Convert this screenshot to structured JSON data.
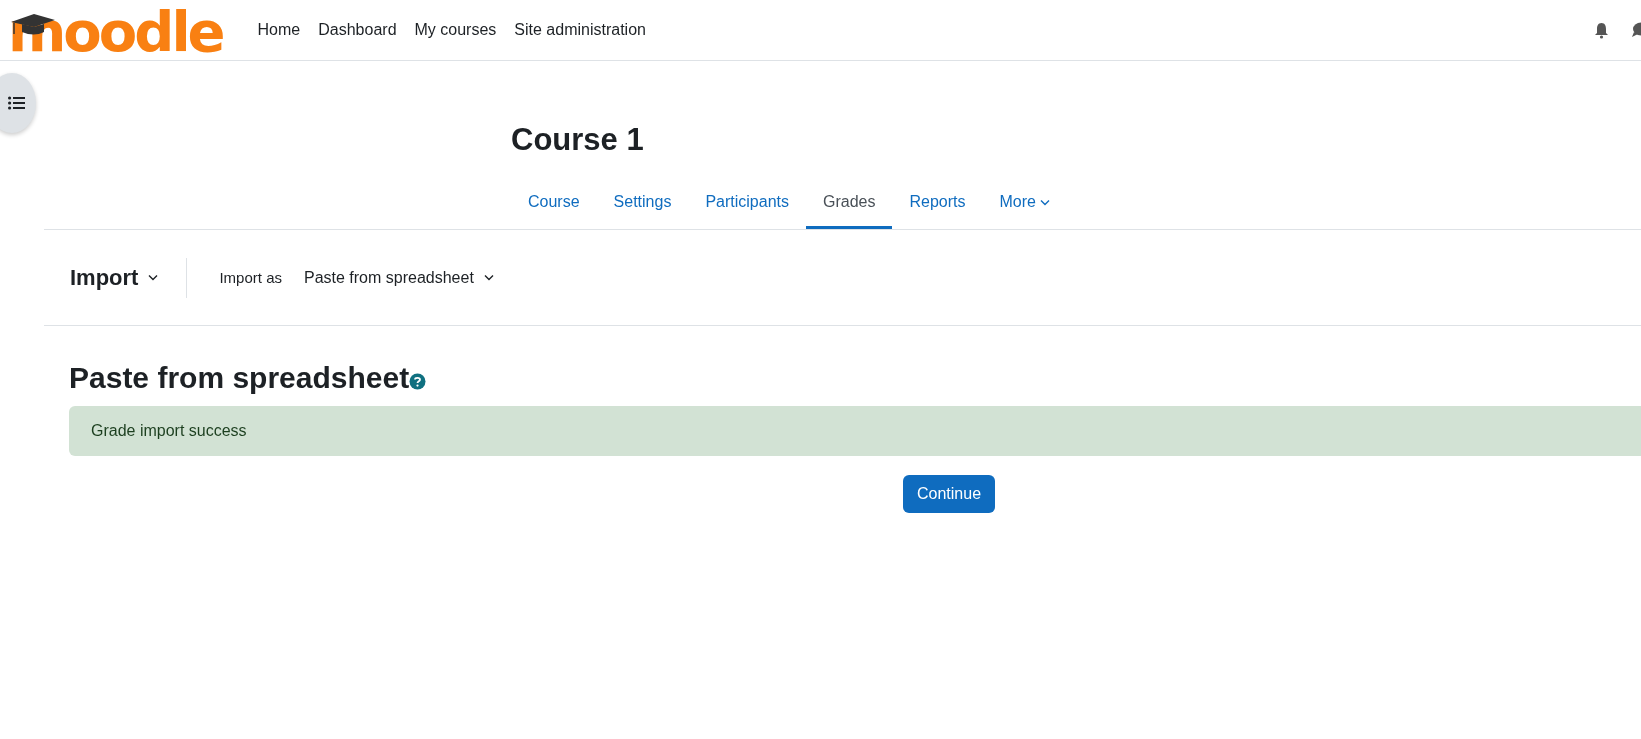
{
  "navbar": {
    "logo": "moodle",
    "links": [
      {
        "label": "Home"
      },
      {
        "label": "Dashboard"
      },
      {
        "label": "My courses"
      },
      {
        "label": "Site administration"
      }
    ]
  },
  "course": {
    "title": "Course 1"
  },
  "tabs": [
    {
      "label": "Course",
      "selected": false,
      "dropdown": false
    },
    {
      "label": "Settings",
      "selected": false,
      "dropdown": false
    },
    {
      "label": "Participants",
      "selected": false,
      "dropdown": false
    },
    {
      "label": "Grades",
      "selected": true,
      "dropdown": false
    },
    {
      "label": "Reports",
      "selected": false,
      "dropdown": false
    },
    {
      "label": "More",
      "selected": false,
      "dropdown": true
    }
  ],
  "action_bar": {
    "menu": "Import",
    "import_as_label": "Import as",
    "import_as_value": "Paste from spreadsheet"
  },
  "content": {
    "heading": "Paste from spreadsheet",
    "alert": "Grade import success",
    "button": "Continue"
  }
}
